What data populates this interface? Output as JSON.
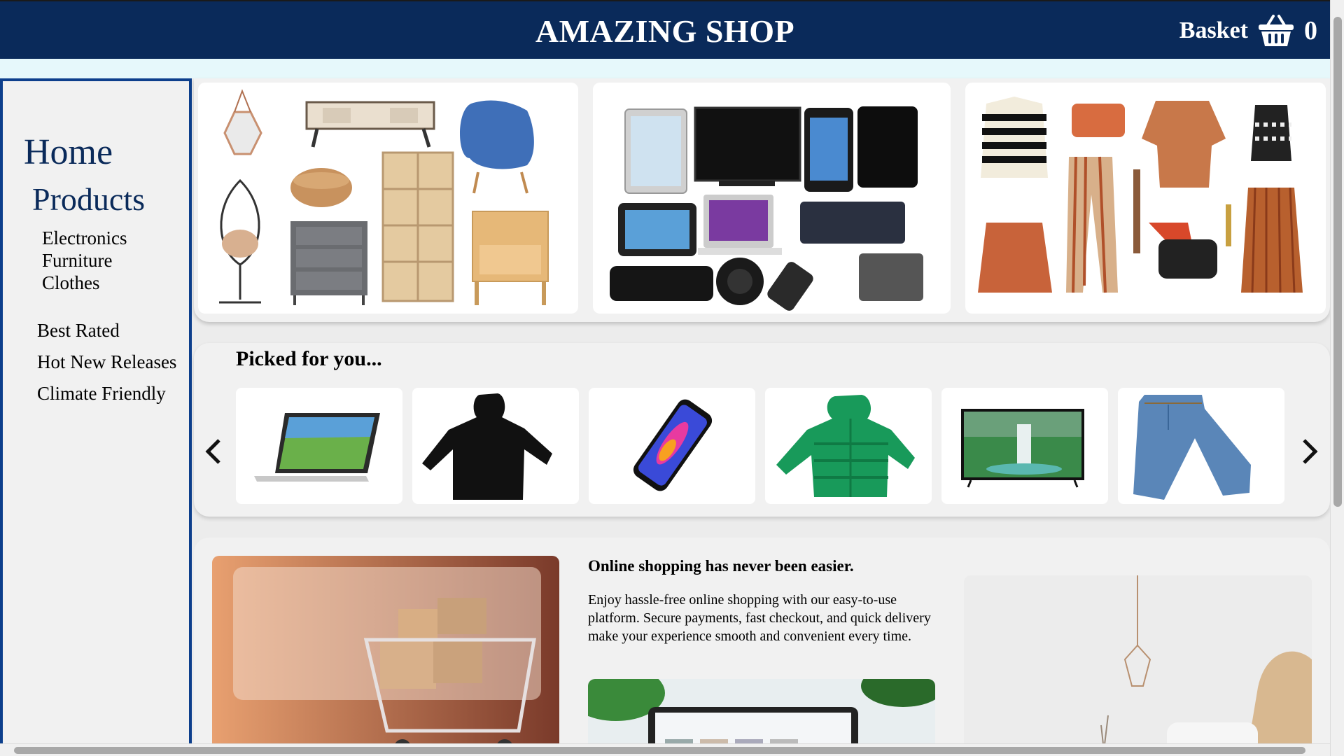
{
  "header": {
    "title": "AMAZING SHOP",
    "basket_label": "Basket",
    "basket_count": "0"
  },
  "sidebar": {
    "home": "Home",
    "products": "Products",
    "categories": [
      "Electronics",
      "Furniture",
      "Clothes"
    ],
    "links": [
      "Best Rated",
      "Hot New Releases",
      "Climate Friendly"
    ]
  },
  "hero": {
    "cards": [
      "furniture",
      "electronics",
      "clothes"
    ]
  },
  "picked": {
    "title": "Picked for you...",
    "prev_icon": "chevron-left-icon",
    "next_icon": "chevron-right-icon",
    "products": [
      "laptop",
      "hoodie",
      "smartphone",
      "puffer-jacket",
      "television",
      "jeans"
    ]
  },
  "info": {
    "heading": "Online shopping has never been easier.",
    "body": "Enjoy hassle-free online shopping with our easy-to-use platform. Secure payments, fast checkout, and quick delivery make your experience smooth and convenient every time."
  },
  "colors": {
    "header_bg": "#0a2a5a",
    "sidebar_border": "#0d3f8c",
    "strip": "#e6f8fb"
  }
}
